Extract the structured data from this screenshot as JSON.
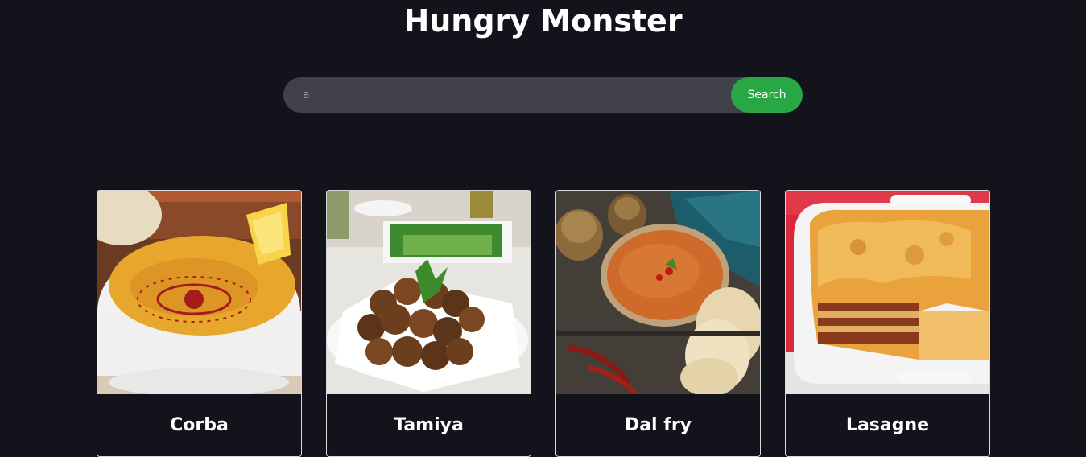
{
  "header": {
    "title": "Hungry Monster"
  },
  "search": {
    "value": "a",
    "button_label": "Search"
  },
  "meals": [
    {
      "name": "Corba"
    },
    {
      "name": "Tamiya"
    },
    {
      "name": "Dal fry"
    },
    {
      "name": "Lasagne"
    }
  ],
  "colors": {
    "background": "#13131c",
    "search_bg": "#414149",
    "accent_green": "#28a745",
    "text": "#ffffff"
  }
}
